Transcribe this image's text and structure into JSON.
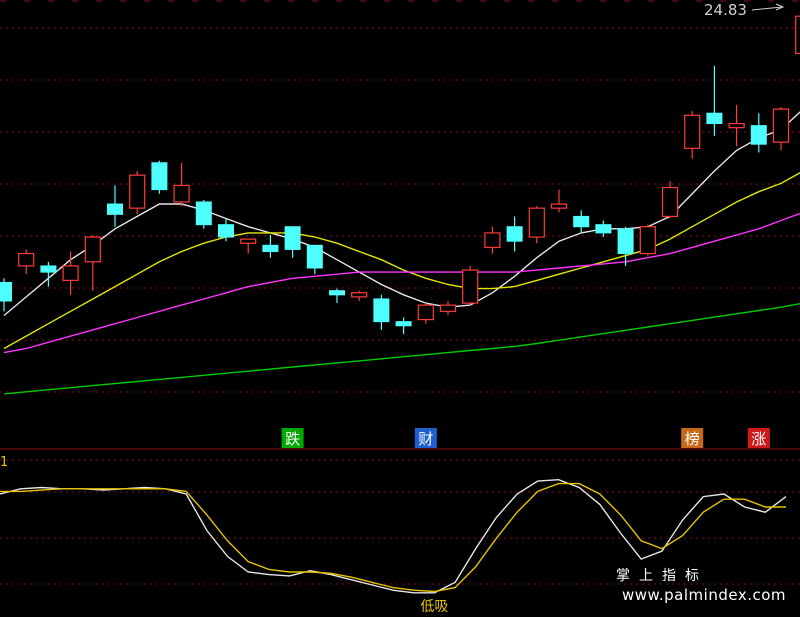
{
  "top_price_label": "24.83",
  "osc_axis_label": "1",
  "watermark": {
    "chinese": "掌上指标",
    "url": "www.palmindex.com"
  },
  "colors": {
    "bg": "#000000",
    "up": "#ff3b3b",
    "down": "#4dffff",
    "grid": "#8a1010",
    "ma5": "#e6e6e6",
    "ma10": "#e6e600",
    "ma20": "#ff33ff",
    "ma60": "#00cc00",
    "k": "#e6e6e6",
    "d": "#e6c200"
  },
  "chart_data": [
    {
      "type": "candlestick",
      "title": "",
      "y_range": [
        15.4,
        24.85
      ],
      "x_count": 35,
      "candles": [
        {
          "o": 18.2,
          "c": 17.75,
          "h": 18.3,
          "l": 17.5
        },
        {
          "o": 18.6,
          "c": 18.9,
          "h": 19.0,
          "l": 18.4
        },
        {
          "o": 18.6,
          "c": 18.45,
          "h": 18.7,
          "l": 18.1
        },
        {
          "o": 18.25,
          "c": 18.6,
          "h": 18.95,
          "l": 17.9
        },
        {
          "o": 18.7,
          "c": 19.3,
          "h": 19.35,
          "l": 18.0
        },
        {
          "o": 20.1,
          "c": 19.85,
          "h": 20.55,
          "l": 19.55
        },
        {
          "o": 20.0,
          "c": 20.8,
          "h": 20.9,
          "l": 19.85
        },
        {
          "o": 21.1,
          "c": 20.45,
          "h": 21.15,
          "l": 20.35
        },
        {
          "o": 20.15,
          "c": 20.55,
          "h": 21.1,
          "l": 20.05
        },
        {
          "o": 20.15,
          "c": 19.6,
          "h": 20.2,
          "l": 19.5
        },
        {
          "o": 19.6,
          "c": 19.3,
          "h": 19.75,
          "l": 19.2
        },
        {
          "o": 19.15,
          "c": 19.25,
          "h": 19.25,
          "l": 18.9
        },
        {
          "o": 19.1,
          "c": 18.95,
          "h": 19.35,
          "l": 18.8
        },
        {
          "o": 19.55,
          "c": 19.0,
          "h": 19.55,
          "l": 18.8
        },
        {
          "o": 19.1,
          "c": 18.55,
          "h": 19.1,
          "l": 18.4
        },
        {
          "o": 18.0,
          "c": 17.9,
          "h": 18.05,
          "l": 17.7
        },
        {
          "o": 17.85,
          "c": 17.95,
          "h": 18.0,
          "l": 17.75
        },
        {
          "o": 17.8,
          "c": 17.25,
          "h": 17.9,
          "l": 17.05
        },
        {
          "o": 17.25,
          "c": 17.15,
          "h": 17.35,
          "l": 16.95
        },
        {
          "o": 17.3,
          "c": 17.65,
          "h": 17.7,
          "l": 17.2
        },
        {
          "o": 17.5,
          "c": 17.65,
          "h": 17.75,
          "l": 17.4
        },
        {
          "o": 17.7,
          "c": 18.5,
          "h": 18.6,
          "l": 17.65
        },
        {
          "o": 19.05,
          "c": 19.4,
          "h": 19.55,
          "l": 18.9
        },
        {
          "o": 19.55,
          "c": 19.2,
          "h": 19.8,
          "l": 18.95
        },
        {
          "o": 19.3,
          "c": 20.0,
          "h": 20.05,
          "l": 19.15
        },
        {
          "o": 20.0,
          "c": 20.1,
          "h": 20.45,
          "l": 19.9
        },
        {
          "o": 19.8,
          "c": 19.55,
          "h": 19.95,
          "l": 19.4
        },
        {
          "o": 19.6,
          "c": 19.4,
          "h": 19.7,
          "l": 19.3
        },
        {
          "o": 19.5,
          "c": 18.9,
          "h": 19.55,
          "l": 18.6
        },
        {
          "o": 18.9,
          "c": 19.55,
          "h": 19.6,
          "l": 18.85
        },
        {
          "o": 19.8,
          "c": 20.5,
          "h": 20.65,
          "l": 19.75
        },
        {
          "o": 21.45,
          "c": 22.25,
          "h": 22.35,
          "l": 21.2
        },
        {
          "o": 22.3,
          "c": 22.05,
          "h": 23.45,
          "l": 21.75
        },
        {
          "o": 21.95,
          "c": 22.05,
          "h": 22.5,
          "l": 21.5
        },
        {
          "o": 22.0,
          "c": 21.55,
          "h": 22.3,
          "l": 21.35
        },
        {
          "o": 21.6,
          "c": 22.4,
          "h": 22.45,
          "l": 21.4
        },
        {
          "o": 23.75,
          "c": 24.65,
          "h": 24.83,
          "l": 23.6
        }
      ],
      "series": [
        {
          "key": "ma5",
          "values": [
            17.4,
            17.85,
            18.3,
            18.75,
            19.1,
            19.5,
            19.8,
            20.1,
            20.1,
            19.95,
            19.75,
            19.55,
            19.4,
            19.25,
            19.05,
            18.75,
            18.45,
            18.15,
            17.9,
            17.7,
            17.6,
            17.65,
            17.95,
            18.35,
            18.8,
            19.2,
            19.4,
            19.5,
            19.5,
            19.55,
            19.8,
            20.35,
            20.9,
            21.4,
            21.7,
            21.9,
            22.4
          ]
        },
        {
          "key": "ma10",
          "values": [
            16.6,
            16.9,
            17.2,
            17.5,
            17.8,
            18.1,
            18.4,
            18.7,
            18.95,
            19.15,
            19.3,
            19.4,
            19.4,
            19.4,
            19.3,
            19.15,
            18.95,
            18.75,
            18.5,
            18.3,
            18.15,
            18.05,
            18.05,
            18.1,
            18.25,
            18.4,
            18.55,
            18.7,
            18.85,
            19.0,
            19.25,
            19.55,
            19.85,
            20.15,
            20.4,
            20.6,
            20.9
          ]
        },
        {
          "key": "ma20",
          "values": [
            16.5,
            16.6,
            16.75,
            16.9,
            17.05,
            17.2,
            17.35,
            17.5,
            17.65,
            17.8,
            17.95,
            18.1,
            18.2,
            18.3,
            18.35,
            18.4,
            18.45,
            18.45,
            18.45,
            18.45,
            18.45,
            18.45,
            18.45,
            18.45,
            18.5,
            18.55,
            18.6,
            18.65,
            18.7,
            18.8,
            18.9,
            19.05,
            19.2,
            19.35,
            19.5,
            19.7,
            19.9
          ]
        },
        {
          "key": "ma60",
          "values": [
            15.5,
            15.55,
            15.6,
            15.65,
            15.7,
            15.75,
            15.8,
            15.85,
            15.9,
            15.95,
            16.0,
            16.05,
            16.1,
            16.15,
            16.2,
            16.25,
            16.3,
            16.35,
            16.4,
            16.45,
            16.5,
            16.55,
            16.6,
            16.65,
            16.72,
            16.8,
            16.88,
            16.96,
            17.04,
            17.12,
            17.2,
            17.28,
            17.36,
            17.44,
            17.52,
            17.6,
            17.7
          ]
        }
      ],
      "signals": [
        {
          "text": "跌",
          "index": 13,
          "bg": "#00aa00",
          "fg": "#ffffff"
        },
        {
          "text": "财",
          "index": 19,
          "bg": "#1f5fd0",
          "fg": "#ffffff"
        },
        {
          "text": "榜",
          "index": 31,
          "bg": "#c66a1a",
          "fg": "#ffffff"
        },
        {
          "text": "涨",
          "index": 34,
          "bg": "#cc1a1a",
          "fg": "#ffffff"
        }
      ]
    },
    {
      "type": "line",
      "title": "",
      "y_range": [
        0,
        100
      ],
      "series": [
        {
          "key": "k",
          "values": [
            80,
            84,
            85,
            84,
            84,
            83,
            84,
            85,
            84,
            80,
            52,
            32,
            20,
            18,
            17,
            21,
            18,
            14,
            10,
            6,
            4,
            4,
            12,
            38,
            62,
            80,
            90,
            91,
            85,
            72,
            50,
            30,
            36,
            60,
            78,
            80,
            70,
            66,
            78
          ]
        },
        {
          "key": "d",
          "values": [
            82,
            82,
            83,
            84,
            84,
            84,
            84,
            84,
            84,
            82,
            64,
            44,
            28,
            22,
            20,
            20,
            19,
            16,
            12,
            8,
            6,
            5,
            8,
            24,
            46,
            66,
            82,
            88,
            88,
            80,
            64,
            44,
            38,
            48,
            66,
            76,
            76,
            70,
            70
          ]
        }
      ],
      "markers": [
        {
          "text": "低吸",
          "index": 21,
          "color": "#e6c200"
        }
      ]
    }
  ]
}
